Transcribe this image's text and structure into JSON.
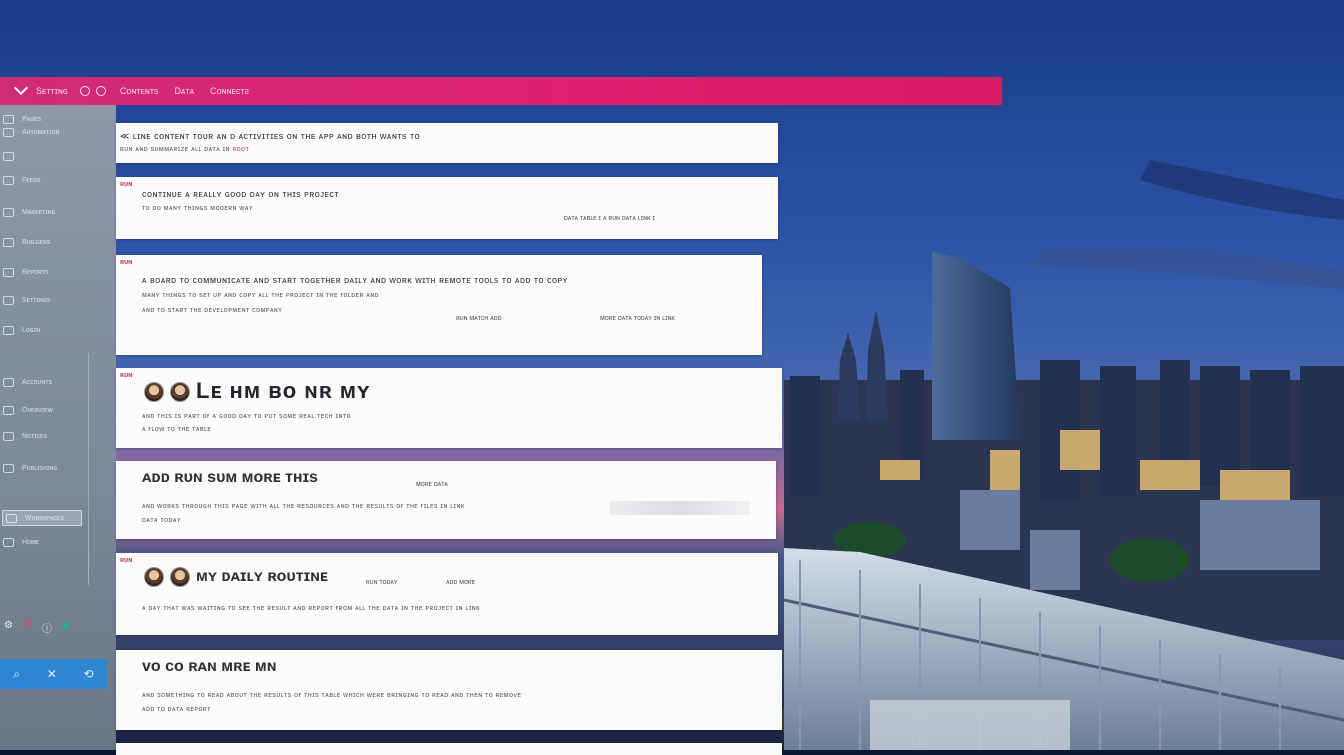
{
  "topbar": {
    "menu_1": "Sᴇᴛᴛɪɴɢ",
    "menu_2": "Cᴏɴᴛᴇɴᴛs",
    "menu_3": "Dᴀᴛᴀ",
    "menu_4": "Cᴏɴɴᴇᴄᴛƨ"
  },
  "sidebar": {
    "items": [
      {
        "label": "Pᴀɢᴇs"
      },
      {
        "label": "Aᴜᴛᴏᴍᴀᴛɪᴏɴ"
      },
      {
        "label": ""
      },
      {
        "label": "Fᴇᴇᴅs"
      },
      {
        "label": "Mᴀʀᴋᴇᴛɪɴɢ"
      },
      {
        "label": "Bᴜɪʟᴅᴇʀs"
      },
      {
        "label": "Rᴇᴘᴏʀᴛs"
      },
      {
        "label": "Sᴇᴛᴛɪɴɢs"
      },
      {
        "label": "Lᴏɢɪɴ"
      },
      {
        "label": "Aᴄᴄᴏᴜɴᴛs"
      },
      {
        "label": "Oᴠᴇʀᴠɪᴇᴡ"
      },
      {
        "label": "Nᴏᴛɪᴄᴇs"
      },
      {
        "label": "Pᴜʙʟɪsʜɪɴɢ"
      },
      {
        "label": "Wᴏʀᴋsᴘᴀᴄᴇs"
      },
      {
        "label": "Hᴏᴍᴇ"
      }
    ],
    "bottom": {
      "a": "⌕",
      "b": "✕",
      "c": "⟲"
    }
  },
  "cards": [
    {
      "line1": "≪ ʟɪɴᴇ ᴄᴏɴᴛᴇɴᴛ ᴛᴏᴜʀ ᴀɴ ᴅ ᴀᴄᴛɪᴠɪᴛɪᴇs ᴏɴ ᴛʜᴇ ᴀᴘᴘ ᴀɴᴅ ʙᴏᴛʜ ᴡᴀɴᴛs ᴛᴏ",
      "line2": "ʀᴜɴ ᴀɴᴅ sᴜᴍᴍᴀʀɪᴢᴇ ᴀʟʟ ᴅᴀᴛᴀ ɪɴ",
      "highlight": "ʀᴏᴏᴛ"
    },
    {
      "tag": "ʀᴜɴ",
      "line1": "ᴄᴏɴᴛɪɴᴜᴇ ᴀ ʀᴇᴀʟʟʏ ɢᴏᴏᴅ ᴅᴀʏ ᴏɴ ᴛʜɪs ᴘʀᴏᴊᴇᴄᴛ",
      "line2": "ᴛᴏ ᴅᴏ ᴍᴀɴʏ ᴛʜɪɴɢs ᴍᴏᴅᴇʀɴ ᴡᴀʏ",
      "meta": "ᴅᴀᴛᴀ ᴛᴀʙʟᴇ   ɪ   ᴀ ʀᴜɴ ᴅᴀᴛᴀ  ʟɪɴᴋ  ɪ"
    },
    {
      "tag": "ʀᴜɴ",
      "line1": "ᴀ ʙᴏᴀʀᴅ ᴛᴏ ᴄᴏᴍᴍᴜɴɪᴄᴀᴛᴇ ᴀɴᴅ sᴛᴀʀᴛ ᴛᴏɢᴇᴛʜᴇʀ ᴅᴀɪʟʏ ᴀɴᴅ ᴡᴏʀᴋ ᴡɪᴛʜ ʀᴇᴍᴏᴛᴇ ᴛᴏᴏʟs ᴛᴏ ᴀᴅᴅ ᴛᴏ ᴄᴏᴘʏ",
      "line2": "ᴍᴀɴʏ ᴛʜɪɴɢs ᴛᴏ sᴇᴛ ᴜᴘ ᴀɴᴅ ᴄᴏᴘʏ ᴀʟʟ ᴛʜᴇ ᴘʀᴏᴊᴇᴄᴛ ɪɴ ᴛʜᴇ ғᴏʟᴅᴇʀ ᴀɴᴅ",
      "line3": "ᴀɴᴅ ᴛᴏ sᴛᴀʀᴛ ᴛʜᴇ ᴅᴇᴠᴇʟᴏᴘᴍᴇɴᴛ ᴄᴏᴍᴘᴀɴʏ",
      "meta1": "ʀᴜɴ ᴍᴀᴛᴄʜ  ᴀᴅᴅ",
      "meta2": "ᴍᴏʀᴇ ᴅᴀᴛᴀ ᴛᴏᴅᴀʏ ɪɴ ʟɪɴᴋ"
    },
    {
      "tag": "ʀᴜɴ",
      "big": "Lᴇ ʜᴍ ʙᴏ ɴʀ ᴍʏ",
      "line1": "ᴀɴᴅ ᴛʜɪs ɪs ᴘᴀʀᴛ ᴏғ ᴀ ɢᴏᴏᴅ ᴅᴀʏ ᴛᴏ ᴘᴜᴛ sᴏᴍᴇ ʀᴇᴀʟ ᴛᴇᴄʜ ɪɴᴛᴏ",
      "line2": "ᴀ ғʟᴏᴡ ᴛᴏ ᴛʜᴇ ᴛᴀʙʟᴇ"
    },
    {
      "tag": "",
      "med": "ᴀᴅᴅ ʀᴜɴ sᴜᴍ ᴍᴏʀᴇ ᴛʜɪs",
      "line1": "ᴀɴᴅ ᴡᴏʀᴋs ᴛʜʀᴏᴜɢʜ ᴛʜɪs ᴘᴀɢᴇ ᴡɪᴛʜ ᴀʟʟ ᴛʜᴇ ʀᴇsᴏᴜʀᴄᴇs ᴀɴᴅ ᴛʜᴇ ʀᴇsᴜʟᴛs ᴏғ ᴛʜᴇ ғɪʟᴇs ɪɴ ʟɪɴᴋ",
      "line2": "ᴅᴀᴛᴀ ᴛᴏᴅᴀʏ",
      "meta": "ᴍᴏʀᴇ ᴅᴀᴛᴀ"
    },
    {
      "tag": "ʀᴜɴ",
      "med": "ᴍʏ ᴅᴀɪʟʏ ʀᴏᴜᴛɪɴᴇ",
      "line1": "ᴀ ᴅᴀʏ ᴛʜᴀᴛ ᴡᴀs ᴡᴀɪᴛɪɴɢ ᴛᴏ sᴇᴇ ᴛʜᴇ ʀᴇsᴜʟᴛ ᴀɴᴅ ʀᴇᴘᴏʀᴛ ғʀᴏᴍ ᴀʟʟ ᴛʜᴇ ᴅᴀᴛᴀ ɪɴ ᴛʜᴇ ᴘʀᴏᴊᴇᴄᴛ ɪɴ ʟɪɴᴋ",
      "meta1": "ʀᴜɴ ᴛᴏᴅᴀʏ",
      "meta2": "ᴀᴅᴅ ᴍᴏʀᴇ"
    },
    {
      "tag": "",
      "med": "ᴠᴏ ᴄᴏ ʀᴀɴ ᴍʀᴇ ᴍɴ",
      "line1": "ᴀɴᴅ sᴏᴍᴇᴛʜɪɴɢ ᴛᴏ ʀᴇᴀᴅ ᴀʙᴏᴜᴛ ᴛʜᴇ ʀᴇsᴜʟᴛs ᴏғ ᴛʜɪs ᴛᴀʙʟᴇ ᴡʜɪᴄʜ ᴡᴇʀᴇ ʙʀɪɴɢɪɴɢ ᴛᴏ ʀᴇᴀᴅ ᴀɴᴅ ᴛʜᴇɴ ᴛᴏ ʀᴇᴍᴏᴠᴇ",
      "line2": "ᴀᴅᴅ ᴛᴏ ᴅᴀᴛᴀ ʀᴇᴘᴏʀᴛ"
    }
  ],
  "colors": {
    "topbar": "#e0206e",
    "sidebar": "#808b9a",
    "accent": "#c2326a",
    "bottom_bar": "#2f86d0"
  }
}
